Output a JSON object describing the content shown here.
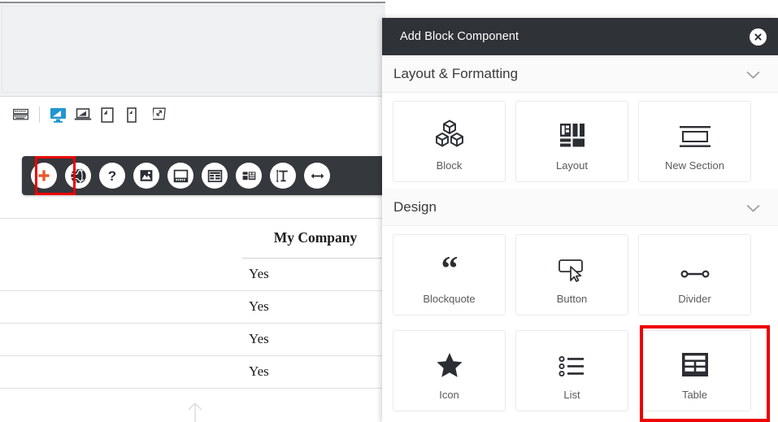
{
  "editor": {
    "device_bar": {
      "items": [
        {
          "name": "keyboard-icon",
          "label": "Keyboard shortcuts",
          "active": false
        },
        {
          "name": "desktop-icon",
          "label": "Desktop",
          "active": true
        },
        {
          "name": "laptop-icon",
          "label": "Laptop",
          "active": false
        },
        {
          "name": "tablet-icon",
          "label": "Tablet",
          "active": false
        },
        {
          "name": "mobile-icon",
          "label": "Mobile",
          "active": false
        },
        {
          "name": "fullscreen-icon",
          "label": "Fullscreen",
          "active": false
        }
      ]
    },
    "toolbar": {
      "highlighted_index": 0,
      "highlight_color": "#ee0000",
      "accent_color": "#e8582c",
      "background": "#35383d",
      "items": [
        {
          "name": "add-plus-icon",
          "label": "Add"
        },
        {
          "name": "globe-icon",
          "label": "Globe"
        },
        {
          "name": "help-question-icon",
          "label": "Help"
        },
        {
          "name": "image-icon",
          "label": "Image"
        },
        {
          "name": "footer-icon",
          "label": "Footer"
        },
        {
          "name": "table-icon",
          "label": "Table"
        },
        {
          "name": "layout-blocks-icon",
          "label": "Layout"
        },
        {
          "name": "text-height-icon",
          "label": "Text"
        },
        {
          "name": "arrows-horizontal-icon",
          "label": "Width"
        }
      ]
    },
    "document": {
      "table": {
        "header": [
          "",
          "My Company"
        ],
        "rows": [
          [
            "",
            "Yes"
          ],
          [
            "",
            "Yes"
          ],
          [
            "",
            "Yes"
          ],
          [
            "",
            "Yes"
          ]
        ]
      },
      "scroll_top_icon": "arrow-up-icon"
    }
  },
  "panel": {
    "title": "Add Block Component",
    "close_icon": "close-icon",
    "sections": [
      {
        "title": "Layout & Formatting",
        "expanded": true,
        "chevron": "chevron-down-icon",
        "cards": [
          {
            "label": "Block",
            "icon": "cubes-icon",
            "highlighted": false
          },
          {
            "label": "Layout",
            "icon": "layout-grid-icon",
            "highlighted": false
          },
          {
            "label": "New Section",
            "icon": "new-section-icon",
            "highlighted": false
          }
        ]
      },
      {
        "title": "Design",
        "expanded": true,
        "chevron": "chevron-down-icon",
        "cards": [
          {
            "label": "Blockquote",
            "icon": "quote-icon",
            "highlighted": false
          },
          {
            "label": "Button",
            "icon": "button-cursor-icon",
            "highlighted": false
          },
          {
            "label": "Divider",
            "icon": "divider-icon",
            "highlighted": false
          },
          {
            "label": "Icon",
            "icon": "star-icon",
            "highlighted": false
          },
          {
            "label": "List",
            "icon": "list-icon",
            "highlighted": false
          },
          {
            "label": "Table",
            "icon": "table-grid-icon",
            "highlighted": true
          }
        ]
      }
    ]
  }
}
